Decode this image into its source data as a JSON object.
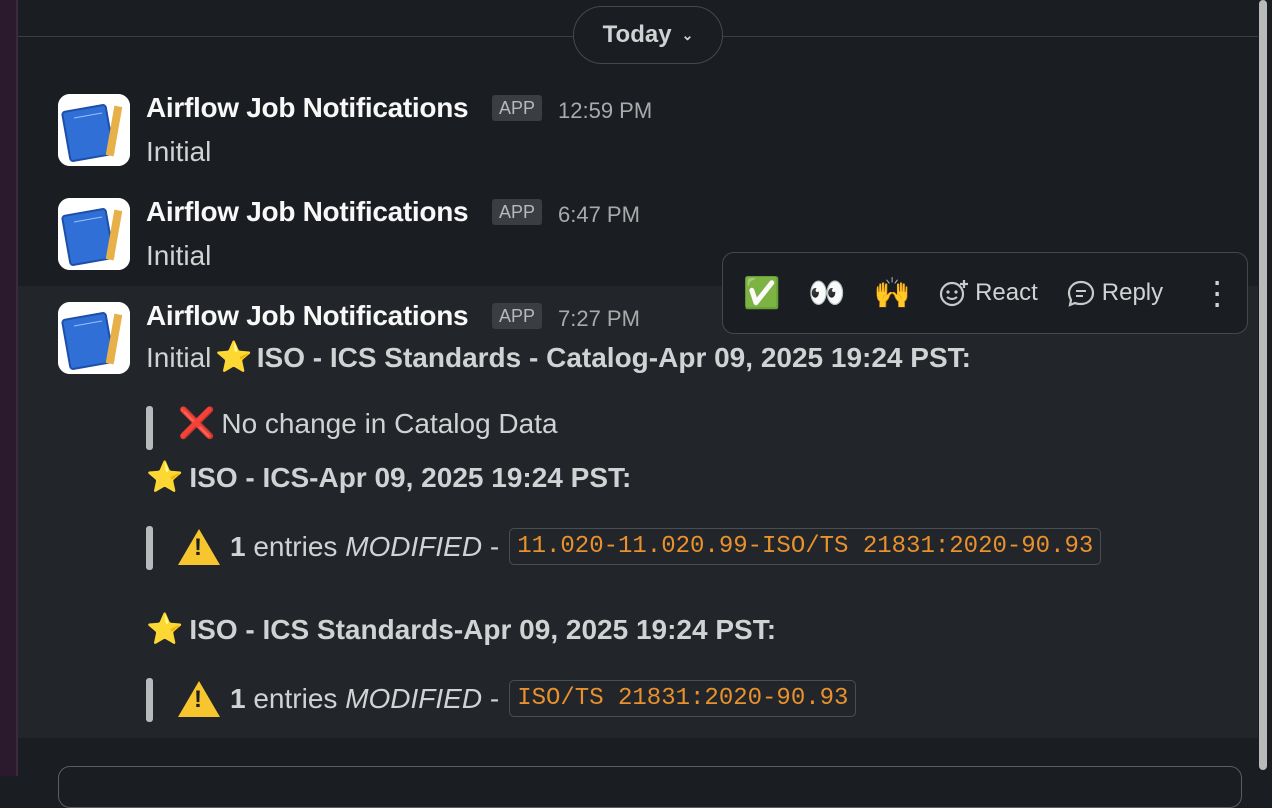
{
  "divider": {
    "label": "Today",
    "chevron": "⌄"
  },
  "messages": [
    {
      "sender": "Airflow Job Notifications",
      "badge": "APP",
      "time": "12:59 PM",
      "text": "Initial"
    },
    {
      "sender": "Airflow Job Notifications",
      "badge": "APP",
      "time": "6:47 PM",
      "text": "Initial"
    },
    {
      "sender": "Airflow Job Notifications",
      "badge": "APP",
      "time": "7:27 PM",
      "first_line_prefix": "Initial",
      "first_line_bold": "ISO - ICS Standards - Catalog-Apr 09, 2025 19:24 PST:",
      "quote1": "No change in Catalog Data",
      "heading2": "ISO - ICS-Apr 09, 2025 19:24 PST:",
      "quote2": {
        "count": "1",
        "entries": "entries",
        "status": "MODIFIED",
        "dash": "-",
        "code": "11.020-11.020.99-ISO/TS 21831:2020-90.93"
      },
      "heading3": "ISO - ICS Standards-Apr 09, 2025 19:24 PST:",
      "quote3": {
        "count": "1",
        "entries": "entries",
        "status": "MODIFIED",
        "dash": "-",
        "code": "ISO/TS 21831:2020-90.93"
      }
    }
  ],
  "toolbar": {
    "emojis": [
      "✅",
      "👀",
      "🙌"
    ],
    "react_label": "React",
    "reply_label": "Reply",
    "more": "⋮"
  },
  "icons": {
    "avatar": "blueprint-notebook-icon",
    "star": "⭐",
    "cross": "❌",
    "warning": "warning-icon",
    "react": "add-reaction-icon",
    "reply": "thread-reply-icon"
  },
  "colors": {
    "background": "#1a1d21",
    "hover_row": "#222529",
    "code_text": "#e8912d",
    "name": "#f8f8f8"
  }
}
